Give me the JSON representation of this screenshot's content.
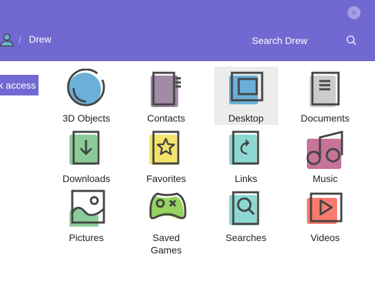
{
  "header": {
    "breadcrumb": "Drew",
    "separator": "/",
    "search_placeholder": "Search Drew",
    "close_icon": "×"
  },
  "sidebar": {
    "button_label": "Quick access"
  },
  "items": [
    {
      "label": "3D Objects",
      "color": "#6ab0d8"
    },
    {
      "label": "Contacts",
      "color": "#a08aa6"
    },
    {
      "label": "Desktop",
      "color": "#6ab0d8",
      "selected": true
    },
    {
      "label": "Documents",
      "color": "#cccccc"
    },
    {
      "label": "Downloads",
      "color": "#8bcb9a"
    },
    {
      "label": "Favorites",
      "color": "#f5e46a"
    },
    {
      "label": "Links",
      "color": "#8cd8d2"
    },
    {
      "label": "Music",
      "color": "#c87399"
    },
    {
      "label": "Pictures",
      "color": "#8bcb9a"
    },
    {
      "label": "Saved Games",
      "color": "#95d35c"
    },
    {
      "label": "Searches",
      "color": "#8cd8d2"
    },
    {
      "label": "Videos",
      "color": "#f97a6e"
    }
  ],
  "colors": {
    "accent": "#7169d1",
    "stroke": "#444444"
  }
}
